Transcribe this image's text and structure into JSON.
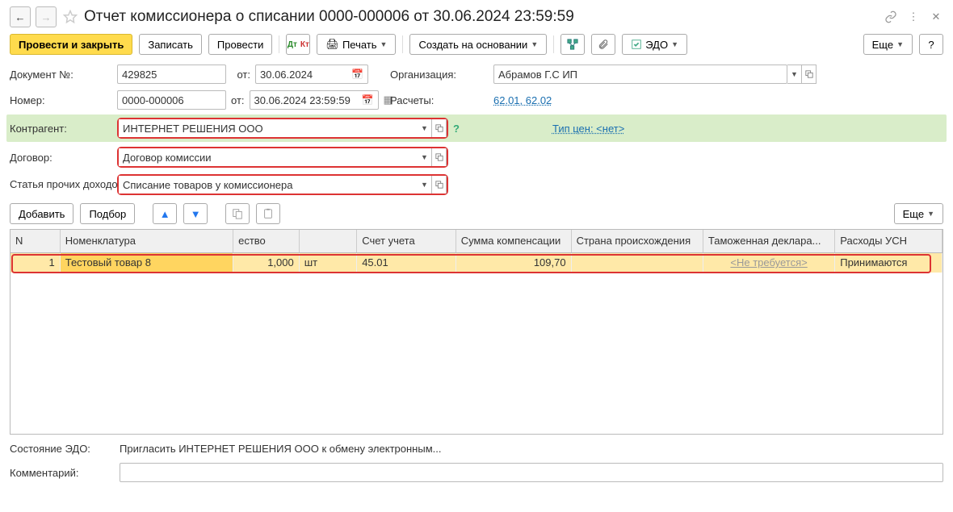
{
  "title": "Отчет комиссионера о списании 0000-000006 от 30.06.2024 23:59:59",
  "toolbar": {
    "post_close": "Провести и закрыть",
    "save": "Записать",
    "post": "Провести",
    "print": "Печать",
    "create_based": "Создать на основании",
    "edo": "ЭДО",
    "more": "Еще"
  },
  "labels": {
    "doc_no": "Документ №:",
    "from": "от:",
    "number": "Номер:",
    "org": "Организация:",
    "calc": "Расчеты:",
    "price_type": "Тип цен:  <нет>",
    "counterparty": "Контрагент:",
    "contract": "Договор:",
    "other_income": "Статья прочих доходов и расходов:",
    "add": "Добавить",
    "select": "Подбор",
    "edo_state": "Состояние ЭДО:",
    "comment": "Комментарий:"
  },
  "values": {
    "doc_no": "429825",
    "doc_date": "30.06.2024",
    "number": "0000-000006",
    "number_date": "30.06.2024 23:59:59",
    "org": "Абрамов Г.С ИП",
    "calc": "62.01, 62.02",
    "counterparty": "ИНТЕРНЕТ РЕШЕНИЯ ООО",
    "contract": "Договор комиссии",
    "other_income": "Списание товаров у комиссионера",
    "edo_state": "Пригласить ИНТЕРНЕТ РЕШЕНИЯ ООО к обмену электронным..."
  },
  "table": {
    "headers": {
      "n": "N",
      "nomen": "Номенклатура",
      "qty": "ество",
      "unit": "",
      "account": "Счет учета",
      "sum": "Сумма компенсации",
      "country": "Страна происхождения",
      "td": "Таможенная деклара...",
      "usn": "Расходы УСН"
    },
    "rows": [
      {
        "n": "1",
        "nomen": "Тестовый товар 8",
        "qty": "1,000",
        "unit": "шт",
        "account": "45.01",
        "sum": "109,70",
        "country": "",
        "td": "<Не требуется>",
        "usn": "Принимаются"
      }
    ]
  }
}
